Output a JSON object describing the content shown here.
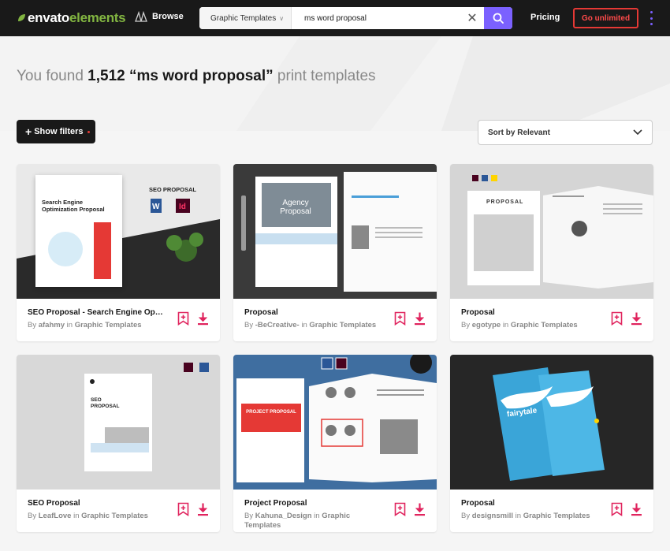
{
  "header": {
    "logo_part1": "envato",
    "logo_part2": "elements",
    "browse_label": "Browse",
    "search_category": "Graphic Templates",
    "search_query": "ms word proposal",
    "pricing_label": "Pricing",
    "cta_label": "Go unlimited"
  },
  "results": {
    "prefix": "You found",
    "count": "1,512",
    "query": "“ms word proposal”",
    "suffix": "print templates"
  },
  "toolbar": {
    "filters_label": "Show filters",
    "sort_label": "Sort by Relevant"
  },
  "items": [
    {
      "title": "SEO Proposal - Search Engine Opti...",
      "by": "By",
      "author": "afahmy",
      "in": "in",
      "category": "Graphic Templates",
      "cover_title": "Search Engine Optimization Proposal",
      "cover_badge": "SEO PROPOSAL"
    },
    {
      "title": "Proposal",
      "by": "By",
      "author": "-BeCreative-",
      "in": "in",
      "category": "Graphic Templates",
      "cover_title": "Agency Proposal"
    },
    {
      "title": "Proposal",
      "by": "By",
      "author": "egotype",
      "in": "in",
      "category": "Graphic Templates",
      "cover_title": "PROPOSAL"
    },
    {
      "title": "SEO Proposal",
      "by": "By",
      "author": "LeafLove",
      "in": "in",
      "category": "Graphic Templates",
      "cover_title": "SEO PROPOSAL"
    },
    {
      "title": "Project Proposal",
      "by": "By",
      "author": "Kahuna_Design",
      "in": "in",
      "category": "Graphic Templates",
      "cover_title": "PROJECT PROPOSAL"
    },
    {
      "title": "Proposal",
      "by": "By",
      "author": "designsmill",
      "in": "in",
      "category": "Graphic Templates",
      "cover_title": "fairytale"
    }
  ],
  "colors": {
    "accent": "#7b61ff",
    "brand_green": "#82b541",
    "action_red": "#e0245e",
    "cta_red": "#e53935"
  },
  "icons": [
    "leaf-logo-icon",
    "browse-icon",
    "chevron-down-icon",
    "clear-icon",
    "search-icon",
    "more-vertical-icon",
    "plus-icon",
    "bookmark-add-icon",
    "download-icon"
  ]
}
